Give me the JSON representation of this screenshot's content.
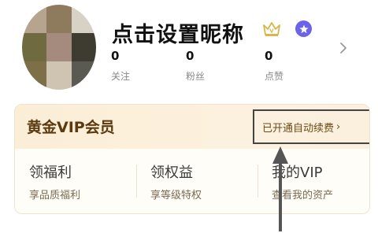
{
  "profile": {
    "nickname": "点击设置昵称",
    "stats": [
      {
        "value": "0",
        "label": "关注"
      },
      {
        "value": "0",
        "label": "粉丝"
      },
      {
        "value": "0",
        "label": "点赞"
      }
    ]
  },
  "vip": {
    "title": "黄金VIP会员",
    "renew_label": "已开通自动续费",
    "renew_chevron": "›",
    "features": [
      {
        "title": "领福利",
        "subtitle": "享品质福利"
      },
      {
        "title": "领权益",
        "subtitle": "享等级特权"
      },
      {
        "title": "我的VIP",
        "subtitle": "查看我的资产"
      }
    ]
  },
  "icons": {
    "crown": "crown-icon",
    "badge": "badge-icon",
    "chevron": "chevron-right-icon"
  },
  "colors": {
    "vip_title": "#5a3a0e",
    "badge": "#6b63e8",
    "card_bg": "#fbf5ea"
  }
}
